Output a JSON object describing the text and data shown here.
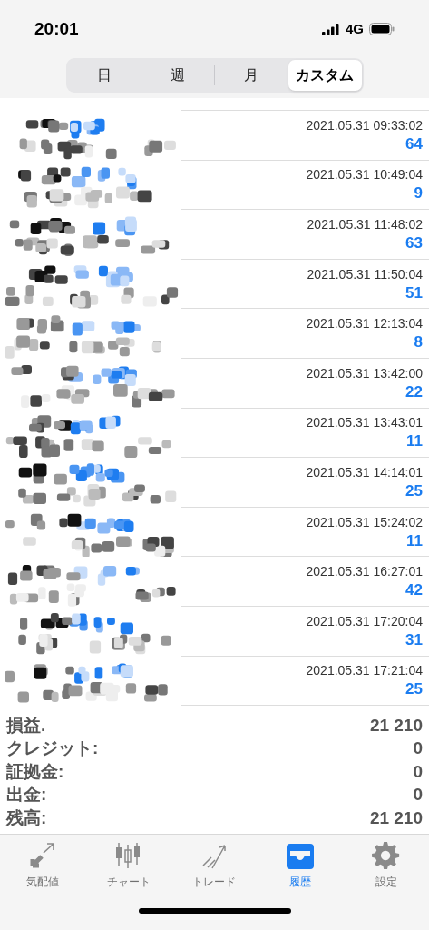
{
  "status_bar": {
    "time": "20:01",
    "network": "4G"
  },
  "tabs": [
    {
      "label": "日",
      "selected": false
    },
    {
      "label": "週",
      "selected": false
    },
    {
      "label": "月",
      "selected": false
    },
    {
      "label": "カスタム",
      "selected": true
    }
  ],
  "deals": [
    {
      "time": "2021.05.31 09:33:02",
      "profit": "64"
    },
    {
      "time": "2021.05.31 10:49:04",
      "profit": "9"
    },
    {
      "time": "2021.05.31 11:48:02",
      "profit": "63"
    },
    {
      "time": "2021.05.31 11:50:04",
      "profit": "51"
    },
    {
      "time": "2021.05.31 12:13:04",
      "profit": "8"
    },
    {
      "time": "2021.05.31 13:42:00",
      "profit": "22"
    },
    {
      "time": "2021.05.31 13:43:01",
      "profit": "11"
    },
    {
      "time": "2021.05.31 14:14:01",
      "profit": "25"
    },
    {
      "time": "2021.05.31 15:24:02",
      "profit": "11"
    },
    {
      "time": "2021.05.31 16:27:01",
      "profit": "42"
    },
    {
      "time": "2021.05.31 17:20:04",
      "profit": "31"
    },
    {
      "time": "2021.05.31 17:21:04",
      "profit": "25"
    }
  ],
  "summary": [
    {
      "label": "損益.",
      "value": "21 210"
    },
    {
      "label": "クレジット:",
      "value": "0"
    },
    {
      "label": "証拠金:",
      "value": "0"
    },
    {
      "label": "出金:",
      "value": "0"
    },
    {
      "label": "残高:",
      "value": "21 210"
    }
  ],
  "tab_bar": [
    {
      "kind": "quotes",
      "label": "気配値",
      "selected": false
    },
    {
      "kind": "chart",
      "label": "チャート",
      "selected": false
    },
    {
      "kind": "trade",
      "label": "トレード",
      "selected": false
    },
    {
      "kind": "history",
      "label": "履歴",
      "selected": true
    },
    {
      "kind": "settings",
      "label": "設定",
      "selected": false
    }
  ]
}
